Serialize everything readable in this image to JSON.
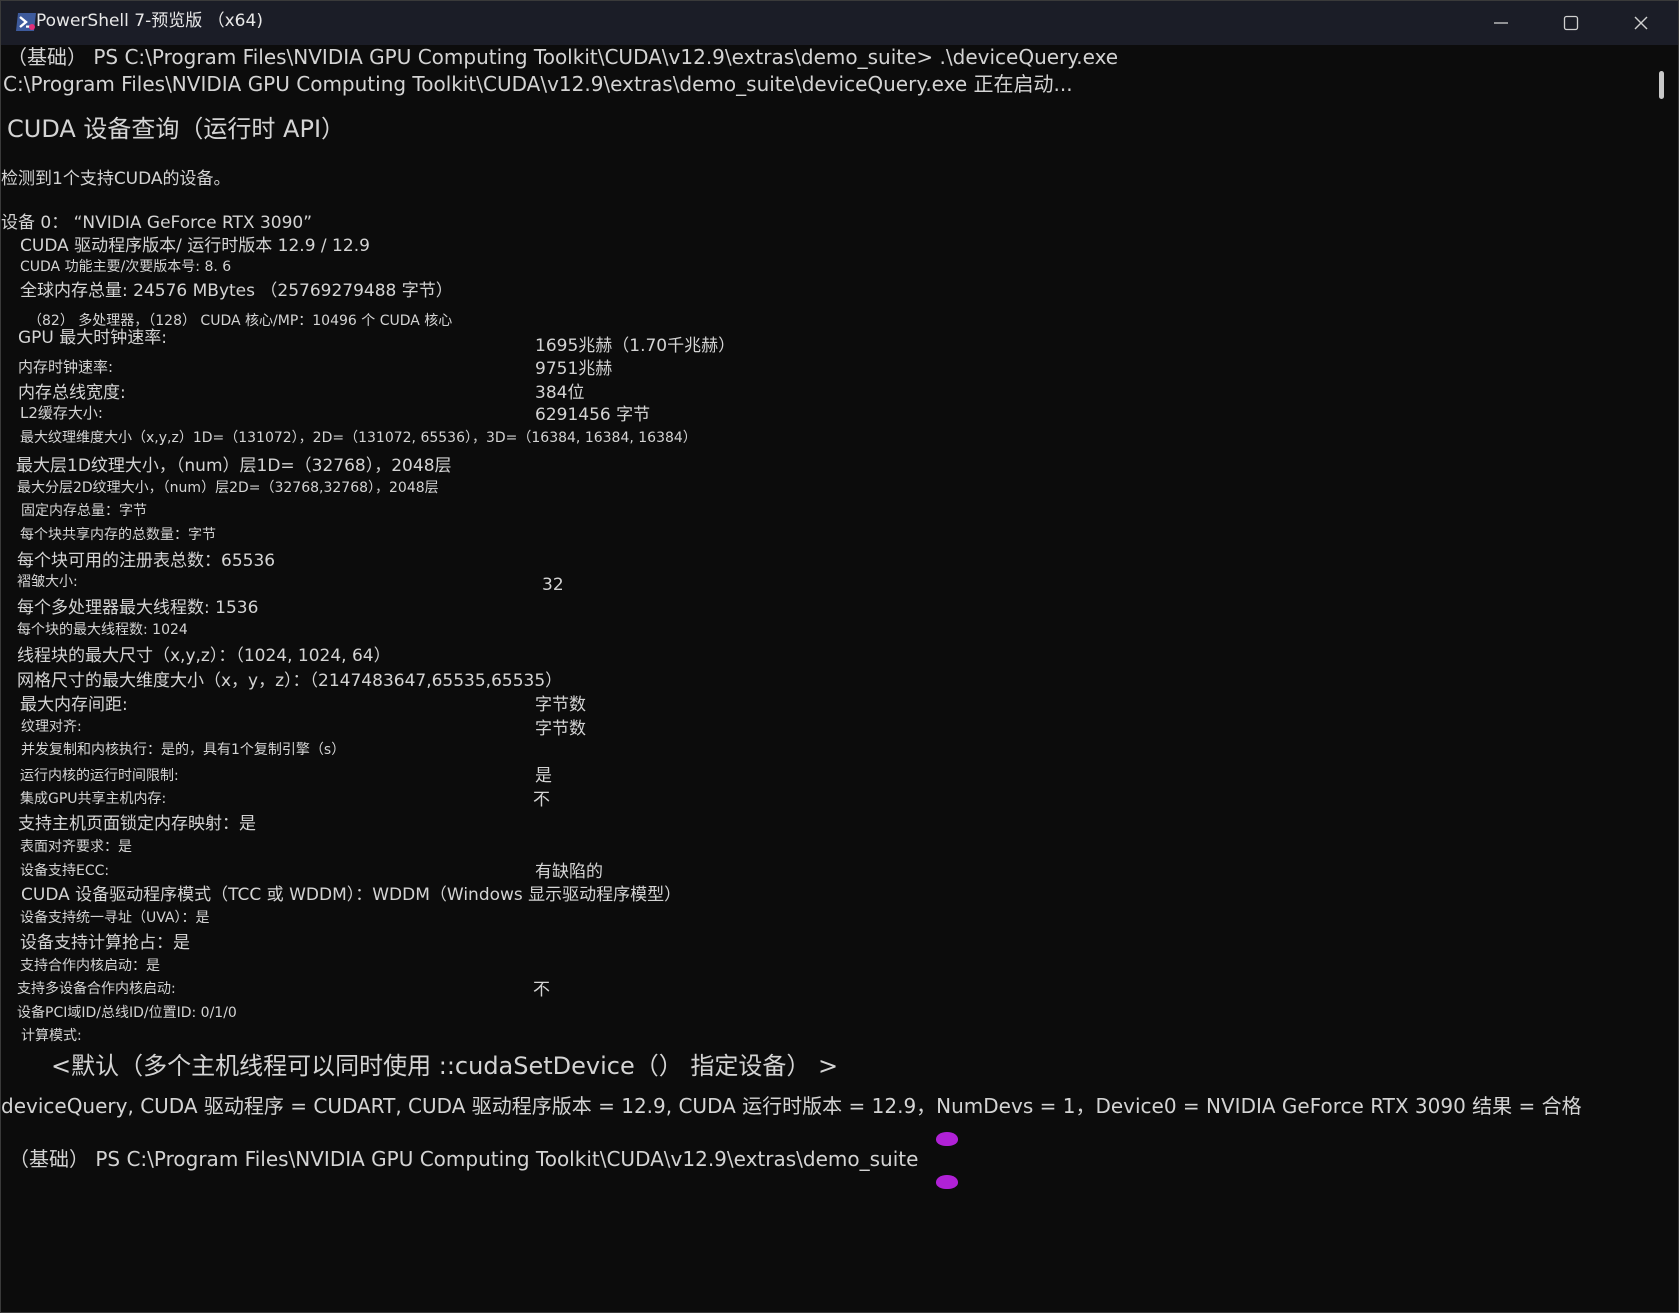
{
  "window": {
    "title": "PowerShell 7-预览版 （x64)",
    "icon": "powershell-icon",
    "buttons": [
      "minimize-icon",
      "maximize-icon",
      "close-icon"
    ]
  },
  "console": {
    "cmd_line": "（基础） PS C:\\Program Files\\NVIDIA GPU Computing Toolkit\\CUDA\\v12.9\\extras\\demo_suite> .\\deviceQuery.exe",
    "start_line": "C:\\Program Files\\NVIDIA GPU Computing Toolkit\\CUDA\\v12.9\\extras\\demo_suite\\deviceQuery.exe 正在启动...",
    "heading": "CUDA 设备查询（运行时 API）",
    "detected": "检测到1个支持CUDA的设备。",
    "device": "设备 0： “NVIDIA GeForce RTX 3090”",
    "driver_version": "CUDA 驱动程序版本/ 运行时版本 12.9 / 12.9",
    "capability": "CUDA 功能主要/次要版本号: 8. 6",
    "global_mem": "全球内存总量: 24576 MBytes （25769279488 字节）",
    "multiprocessors": "（82） 多处理器，（128） CUDA 核心/MP：10496 个 CUDA 核心",
    "gpu_clock_label": "GPU 最大时钟速率:",
    "gpu_clock_value": "1695兆赫（1.70千兆赫）",
    "mem_clock_label": "内存时钟速率:",
    "mem_clock_value": "9751兆赫",
    "bus_width_label": "内存总线宽度:",
    "bus_width_value": "384位",
    "l2_label": "L2缓存大小:",
    "l2_value": "6291456 字节",
    "max_texture": "最大纹理维度大小（x,y,z）1D=（131072），2D=（131072, 65536），3D=（16384, 16384, 16384）",
    "max_layered_1d": "最大层1D纹理大小，（num）层1D=（32768），2048层",
    "max_layered_2d": "最大分层2D纹理大小，（num）层2D=（32768,32768），2048层",
    "const_mem": "固定内存总量：字节",
    "shared_mem": "每个块共享内存的总数量：字节",
    "registers": "每个块可用的注册表总数：65536",
    "warp_label": "褶皱大小:",
    "warp_value": "32",
    "threads_per_mp": "每个多处理器最大线程数: 1536",
    "threads_per_block": "每个块的最大线程数: 1024",
    "block_dim": "线程块的最大尺寸（x,y,z）：（1024, 1024, 64）",
    "grid_dim": "网格尺寸的最大维度大小（x，y，z）：（2147483647,65535,65535）",
    "mem_pitch_label": "最大内存间距:",
    "mem_pitch_value": "字节数",
    "tex_align_label": "纹理对齐:",
    "tex_align_value": "字节数",
    "concurrent_copy": "并发复制和内核执行：是的，具有1个复制引擎（s）",
    "runtime_limit_label": "运行内核的运行时间限制:",
    "runtime_limit_value": "是",
    "integrated_label": "集成GPU共享主机内存:",
    "integrated_value": "不",
    "host_mapping": "支持主机页面锁定内存映射：是",
    "surface_align": "表面对齐要求：是",
    "ecc_label": "设备支持ECC:",
    "ecc_value": "有缺陷的",
    "driver_mode": "CUDA 设备驱动程序模式（TCC 或 WDDM）：WDDM（Windows 显示驱动程序模型）",
    "uva": "设备支持统一寻址（UVA）：是",
    "preemption": "设备支持计算抢占：是",
    "coop_launch": "支持合作内核启动：是",
    "multi_coop_label": "支持多设备合作内核启动:",
    "multi_coop_value": "不",
    "pci": "设备PCI域ID/总线ID/位置ID: 0/1/0",
    "compute_mode_label": "计算模式:",
    "compute_mode_value": "<默认（多个主机线程可以同时使用 ::cudaSetDevice（） 指定设备） >",
    "summary": "deviceQuery, CUDA 驱动程序 = CUDART, CUDA 驱动程序版本 = 12.9, CUDA 运行时版本 = 12.9，NumDevs = 1，Device0 = NVIDIA GeForce RTX 3090 结果 = 合格",
    "prompt": "（基础） PS C:\\Program Files\\NVIDIA GPU Computing Toolkit\\CUDA\\v12.9\\extras\\demo_suite"
  },
  "colors": {
    "background": "#0c0c0c",
    "titlebar": "#1b1d27",
    "text": "#d4d4d4",
    "cursor": "#b021d6"
  }
}
